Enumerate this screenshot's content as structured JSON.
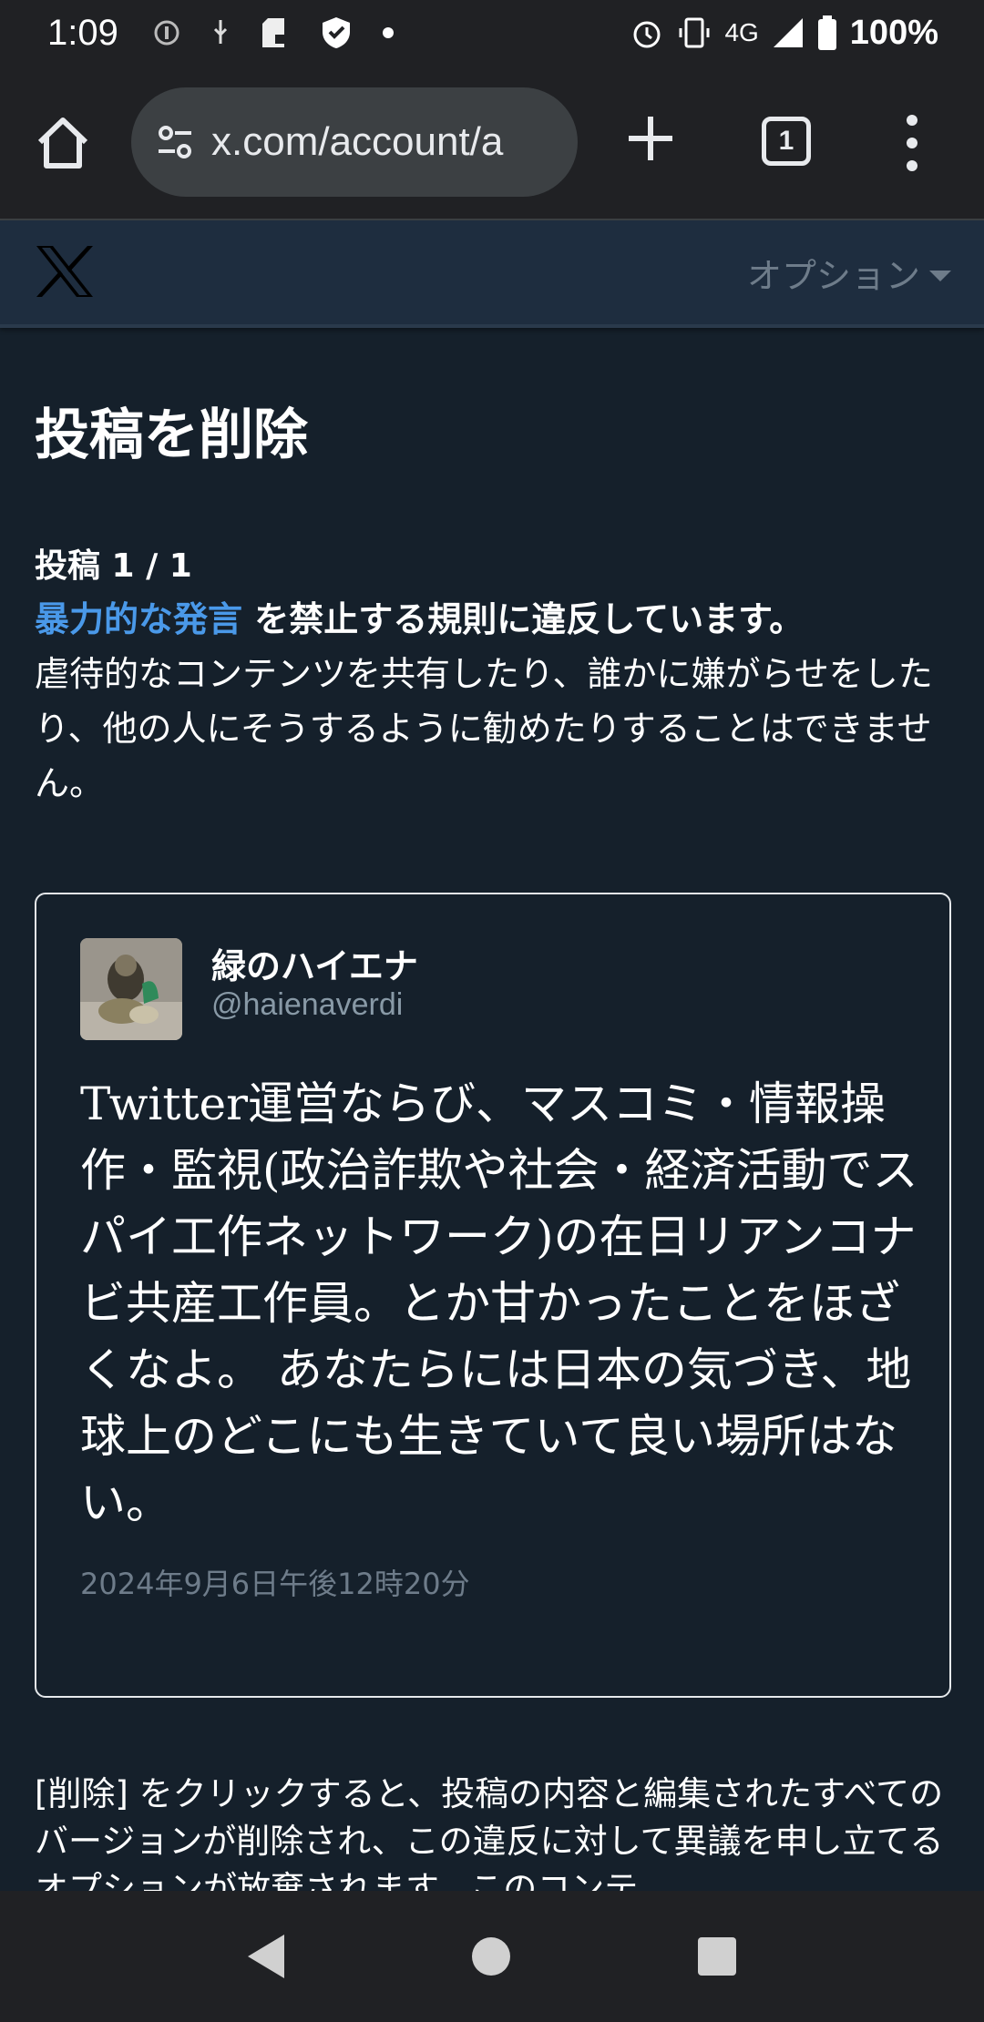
{
  "status_bar": {
    "time": "1:09",
    "network": "4G",
    "battery": "100%"
  },
  "browser": {
    "url": "x.com/account/a",
    "tab_count": "1"
  },
  "header": {
    "logo": "X",
    "options_label": "オプション"
  },
  "page": {
    "title": "投稿を削除",
    "post_count": "投稿 1 / 1",
    "rule_link": "暴力的な発言",
    "rule_rest": " を禁止する規則に違反しています。",
    "rule_description": "虐待的なコンテンツを共有したり、誰かに嫌がらせをしたり、他の人にそうするように勧めたりすることはできません。"
  },
  "tweet": {
    "display_name": "緑のハイエナ",
    "handle": "@haienaverdi",
    "text": "Twitter運営ならび、マスコミ・情報操作・監視(政治詐欺や社会・経済活動でスパイ工作ネットワーク)の在日リアンコナビ共産工作員。とか甘かったことをほざくなよ。 あなたらには日本の気づき、地球上のどこにも生きていて良い場所はない。",
    "timestamp": "2024年9月6日午後12時20分"
  },
  "footer": {
    "text": "[削除] をクリックすると、投稿の内容と編集されたすべてのバージョンが削除され、この違反に対して異議を申し立てるオプションが放棄されます。このコンテ"
  },
  "colors": {
    "background": "#15202b",
    "header": "#1e2d3f",
    "link": "#4a99e9",
    "muted": "#6e7c8a"
  }
}
